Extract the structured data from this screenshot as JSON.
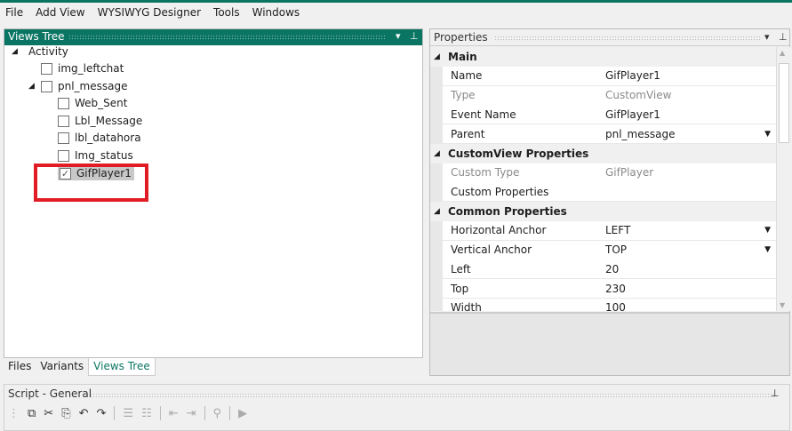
{
  "menu": [
    {
      "label": "File"
    },
    {
      "label": "Add View"
    },
    {
      "label": "WYSIWYG Designer"
    },
    {
      "label": "Tools"
    },
    {
      "label": "Windows"
    }
  ],
  "views_tree": {
    "title": "Views Tree",
    "items": [
      {
        "label": "Activity",
        "level": 0,
        "checkbox": false,
        "expanded": true
      },
      {
        "label": "img_leftchat",
        "level": 1,
        "checkbox": true,
        "checked": false
      },
      {
        "label": "pnl_message",
        "level": 1,
        "checkbox": true,
        "checked": false,
        "expanded": true
      },
      {
        "label": "Web_Sent",
        "level": 2,
        "checkbox": true,
        "checked": false
      },
      {
        "label": "Lbl_Message",
        "level": 2,
        "checkbox": true,
        "checked": false
      },
      {
        "label": "lbl_datahora",
        "level": 2,
        "checkbox": true,
        "checked": false
      },
      {
        "label": "Img_status",
        "level": 2,
        "checkbox": true,
        "checked": false
      },
      {
        "label": "GifPlayer1",
        "level": 2,
        "checkbox": true,
        "checked": true,
        "selected": true
      }
    ]
  },
  "bottom_tabs": [
    {
      "label": "Files"
    },
    {
      "label": "Variants"
    },
    {
      "label": "Views Tree",
      "active": true
    }
  ],
  "properties": {
    "title": "Properties",
    "rows": [
      {
        "category": "Main"
      },
      {
        "name": "Name",
        "value": "GifPlayer1"
      },
      {
        "name": "Type",
        "value": "CustomView",
        "disabled": true
      },
      {
        "name": "Event Name",
        "value": "GifPlayer1"
      },
      {
        "name": "Parent",
        "value": "pnl_message",
        "dropdown": true
      },
      {
        "category": "CustomView Properties"
      },
      {
        "name": "Custom Type",
        "value": "GifPlayer",
        "disabled": true
      },
      {
        "name": "Custom Properties",
        "value": ""
      },
      {
        "category": "Common Properties"
      },
      {
        "name": "Horizontal Anchor",
        "value": "LEFT",
        "dropdown": true
      },
      {
        "name": "Vertical Anchor",
        "value": "TOP",
        "dropdown": true
      },
      {
        "name": "Left",
        "value": "20"
      },
      {
        "name": "Top",
        "value": "230"
      },
      {
        "name": "Width",
        "value": "100"
      }
    ]
  },
  "script": {
    "title": "Script - General"
  },
  "colors": {
    "accent": "#0a7563",
    "highlight_box": "#e21c25"
  }
}
